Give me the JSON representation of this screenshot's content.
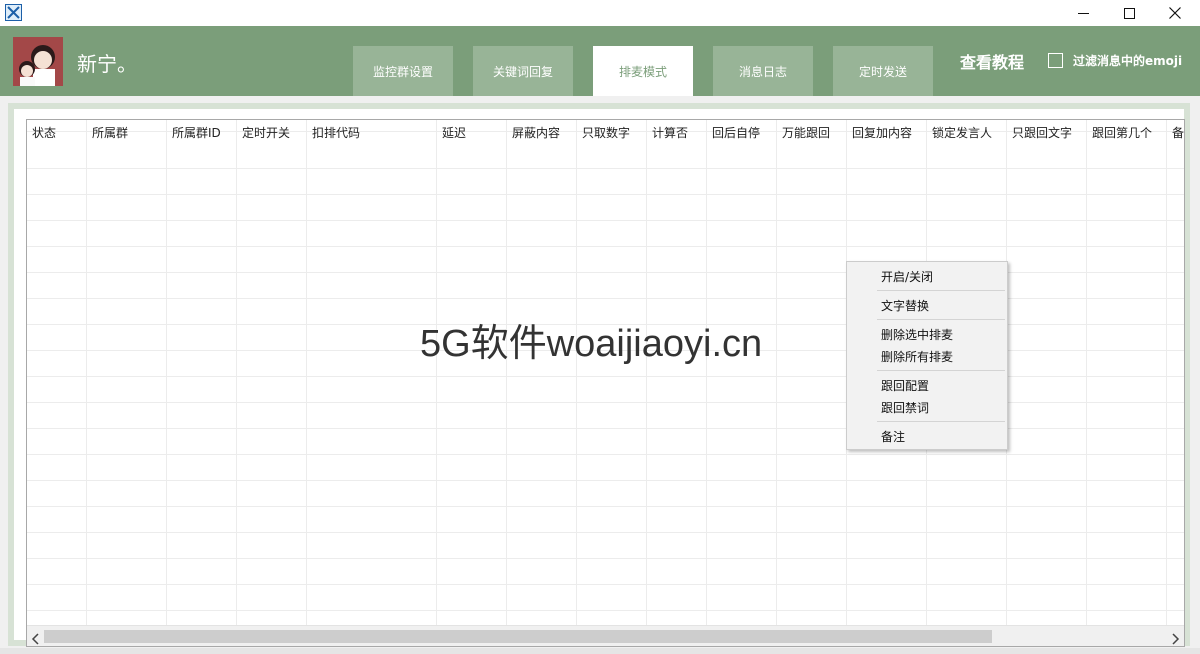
{
  "window": {
    "minimize_icon": "minimize-icon",
    "maximize_icon": "maximize-icon",
    "close_icon": "close-icon"
  },
  "colors": {
    "header_bg": "#7b9e7a",
    "tab_bg": "#98b497",
    "active_tab_bg": "#ffffff",
    "frame_border": "#d7e2d5"
  },
  "header": {
    "username": "新宁。",
    "tabs": [
      {
        "label": "监控群设置"
      },
      {
        "label": "关键词回复"
      },
      {
        "label": "排麦模式"
      },
      {
        "label": "消息日志"
      },
      {
        "label": "定时发送"
      }
    ],
    "active_tab": "排麦模式",
    "tutorial_link": "查看教程",
    "filter_emoji_label": "过滤消息中的emoji",
    "filter_emoji_checked": false
  },
  "grid": {
    "columns": [
      "状态",
      "所属群",
      "所属群ID",
      "定时开关",
      "扣排代码",
      "延迟",
      "屏蔽内容",
      "只取数字",
      "计算否",
      "回后自停",
      "万能跟回",
      "回复加内容",
      "锁定发言人",
      "只跟回文字",
      "跟回第几个",
      "备注"
    ],
    "rows": []
  },
  "watermark": "5G软件woaijiaoyi.cn",
  "context_menu": {
    "items": [
      "开启/关闭",
      "文字替换",
      "删除选中排麦",
      "删除所有排麦",
      "跟回配置",
      "跟回禁词",
      "备注"
    ]
  }
}
